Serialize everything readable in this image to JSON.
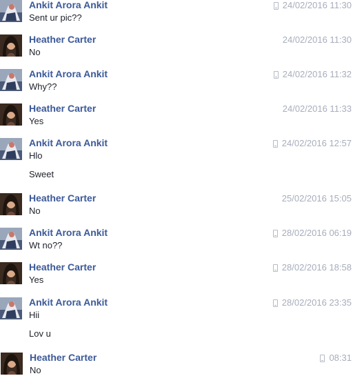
{
  "messages": [
    {
      "sender": "Ankit Arora Ankit",
      "avatar": "ankit",
      "mobile": true,
      "time": "24/02/2016 11:30",
      "lines": [
        "Sent ur pic??"
      ]
    },
    {
      "sender": "Heather Carter",
      "avatar": "heather",
      "mobile": false,
      "time": "24/02/2016 11:30",
      "lines": [
        "No"
      ]
    },
    {
      "sender": "Ankit Arora Ankit",
      "avatar": "ankit",
      "mobile": true,
      "time": "24/02/2016 11:32",
      "lines": [
        "Why??"
      ]
    },
    {
      "sender": "Heather Carter",
      "avatar": "heather",
      "mobile": false,
      "time": "24/02/2016 11:33",
      "lines": [
        "Yes"
      ]
    },
    {
      "sender": "Ankit Arora Ankit",
      "avatar": "ankit",
      "mobile": true,
      "time": "24/02/2016 12:57",
      "lines": [
        "Hlo",
        "Sweet"
      ]
    },
    {
      "sender": "Heather Carter",
      "avatar": "heather",
      "mobile": false,
      "time": "25/02/2016 15:05",
      "lines": [
        "No"
      ]
    },
    {
      "sender": "Ankit Arora Ankit",
      "avatar": "ankit",
      "mobile": true,
      "time": "28/02/2016 06:19",
      "lines": [
        "Wt no??"
      ]
    },
    {
      "sender": "Heather Carter",
      "avatar": "heather",
      "mobile": true,
      "time": "28/02/2016 18:58",
      "lines": [
        "Yes"
      ]
    },
    {
      "sender": "Ankit Arora Ankit",
      "avatar": "ankit",
      "mobile": true,
      "time": "28/02/2016 23:35",
      "lines": [
        "Hii",
        "Lov u"
      ]
    },
    {
      "sender": "Heather Carter",
      "avatar": "heather",
      "mobile": true,
      "time": "08:31",
      "lines": [
        "No"
      ]
    }
  ],
  "colors": {
    "sender_name": "#3b5998",
    "timestamp": "#a7adbb",
    "message_text": "#1d2129"
  }
}
